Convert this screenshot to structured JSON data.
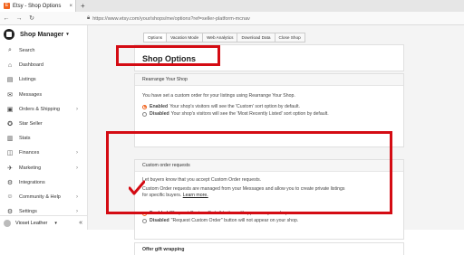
{
  "browser": {
    "tab_title": "Etsy - Shop Options",
    "tab_close": "×",
    "new_tab": "+",
    "url": "https://www.etsy.com/your/shops/me/options?ref=seller-platform-mcnav",
    "back": "←",
    "forward": "→",
    "reload": "↻"
  },
  "sidebar": {
    "title": "Shop Manager",
    "items": [
      {
        "label": "Search",
        "icon": "search-icon",
        "glyph": "⌕"
      },
      {
        "label": "Dashboard",
        "icon": "dashboard-icon",
        "glyph": "⌂"
      },
      {
        "label": "Listings",
        "icon": "listings-icon",
        "glyph": "▤"
      },
      {
        "label": "Messages",
        "icon": "messages-icon",
        "glyph": "✉"
      },
      {
        "label": "Orders & Shipping",
        "icon": "orders-icon",
        "glyph": "▣",
        "arrow": "›"
      },
      {
        "label": "Star Seller",
        "icon": "star-seller-icon",
        "glyph": "✪"
      },
      {
        "label": "Stats",
        "icon": "stats-icon",
        "glyph": "▥"
      },
      {
        "label": "Finances",
        "icon": "finances-icon",
        "glyph": "◫",
        "arrow": "›"
      },
      {
        "label": "Marketing",
        "icon": "marketing-icon",
        "glyph": "✈",
        "arrow": "›"
      },
      {
        "label": "Integrations",
        "icon": "integrations-icon",
        "glyph": "⚙"
      },
      {
        "label": "Community & Help",
        "icon": "community-icon",
        "glyph": "☺",
        "arrow": "›"
      },
      {
        "label": "Settings",
        "icon": "settings-icon",
        "glyph": "⚙",
        "arrow": "›"
      }
    ],
    "footer_name": "Vioset Leather",
    "footer_caret": "▾",
    "collapse": "«"
  },
  "tabs": [
    "Options",
    "Vacation Mode",
    "Web Analytics",
    "Download Data",
    "Close Shop"
  ],
  "page_title": "Shop Options",
  "rearrange": {
    "heading": "Rearrange Your Shop",
    "desc": "You have set a custom order for your listings using Rearrange Your Shop.",
    "opt1_bold": "Enabled",
    "opt1_text": "Your shop's visitors will see the 'Custom' sort option by default.",
    "opt2_bold": "Disabled",
    "opt2_text": "Your shop's visitors will see the 'Most Recently Listed' sort option by default."
  },
  "custom_orders": {
    "heading": "Custom order requests",
    "desc1": "Let buyers know that you accept Custom Order requests.",
    "desc2": "Custom Order requests are managed from your Messages and allow you to create private listings",
    "desc3": "for specific buyers.",
    "learn_more": "Learn more.",
    "opt1_bold": "Enabled",
    "opt1_text": "\"Request Custom Order\" button will appear on your shop.",
    "opt2_bold": "Disabled",
    "opt2_text": "\"Request Custom Order\" button will not appear on your shop."
  },
  "gift": {
    "heading": "Offer gift wrapping"
  },
  "colors": {
    "accent": "#f1641e",
    "annotation": "#d40b13"
  }
}
